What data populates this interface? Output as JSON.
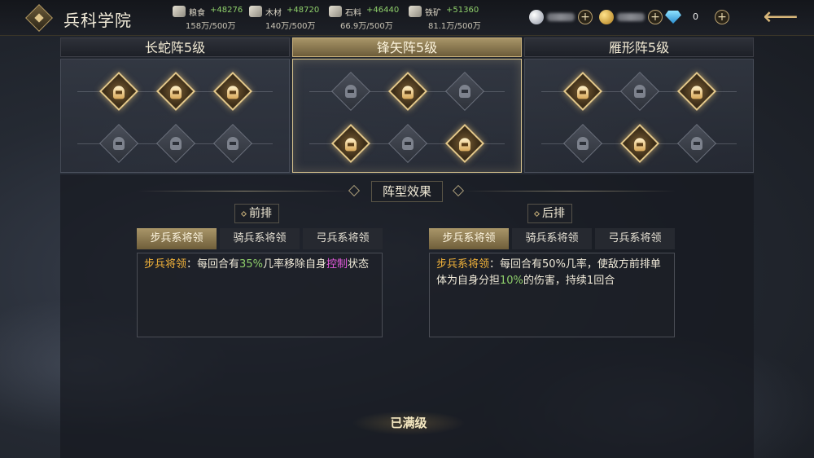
{
  "header": {
    "title": "兵科学院",
    "back_icon": "back-arrow-icon"
  },
  "resources": [
    {
      "label": "粮食",
      "gain": "+48276",
      "cap": "158万/500万",
      "icon": "grain-icon"
    },
    {
      "label": "木材",
      "gain": "+48720",
      "cap": "140万/500万",
      "icon": "wood-icon"
    },
    {
      "label": "石料",
      "gain": "+46440",
      "cap": "66.9万/500万",
      "icon": "stone-icon"
    },
    {
      "label": "铁矿",
      "gain": "+51360",
      "cap": "81.1万/500万",
      "icon": "iron-icon"
    }
  ],
  "currencies": {
    "silver_icon": "silver-coin-icon",
    "gold_icon": "gold-coin-icon",
    "gem_icon": "diamond-gem-icon",
    "gem_value": "0",
    "plus_label": "+"
  },
  "formations": [
    {
      "name": "长蛇阵5级",
      "selected": false,
      "row1": [
        true,
        true,
        true
      ],
      "row2": [
        false,
        false,
        false
      ]
    },
    {
      "name": "锋矢阵5级",
      "selected": true,
      "row1": [
        false,
        true,
        false
      ],
      "row2": [
        true,
        false,
        true
      ]
    },
    {
      "name": "雁形阵5级",
      "selected": false,
      "row1": [
        true,
        false,
        true
      ],
      "row2": [
        false,
        true,
        false
      ]
    }
  ],
  "effects": {
    "title": "阵型效果",
    "front": {
      "label": "前排",
      "tabs": [
        "步兵系将领",
        "骑兵系将领",
        "弓兵系将领"
      ],
      "active_tab": 0,
      "desc": {
        "lead": "步兵将领",
        "sep": "：",
        "t1": "每回合有",
        "pct": "35%",
        "t2": "几率移除自身",
        "ctrl": "控制",
        "t3": "状态"
      }
    },
    "back": {
      "label": "后排",
      "tabs": [
        "步兵系将领",
        "骑兵系将领",
        "弓兵系将领"
      ],
      "active_tab": 0,
      "desc": {
        "lead": "步兵系将领",
        "sep": "：",
        "t1": "每回合有50%几率，使敌方前排单体为自身分担",
        "pct": "10%",
        "t2": "的伤害，持续1回合"
      }
    },
    "status": "已满级"
  }
}
